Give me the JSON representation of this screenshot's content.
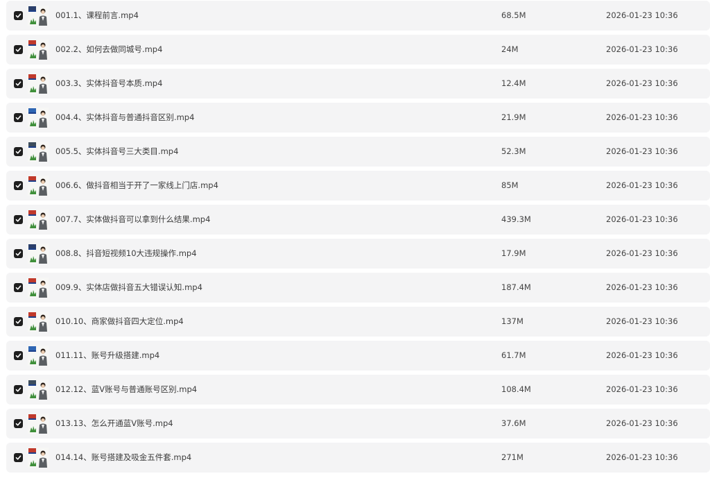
{
  "colors": {
    "row_background": "#f4f4f5",
    "checkbox": "#1f1f1f",
    "text": "#3c3c3c"
  },
  "files": [
    {
      "name": "001.1、课程前言.mp4",
      "size": "68.5M",
      "modified": "2026-01-23 10:36",
      "checked": true,
      "thumb_icon": "video-thumbnail"
    },
    {
      "name": "002.2、如何去做同城号.mp4",
      "size": "24M",
      "modified": "2026-01-23 10:36",
      "checked": true,
      "thumb_icon": "video-thumbnail"
    },
    {
      "name": "003.3、实体抖音号本质.mp4",
      "size": "12.4M",
      "modified": "2026-01-23 10:36",
      "checked": true,
      "thumb_icon": "video-thumbnail"
    },
    {
      "name": "004.4、实体抖音与普通抖音区别.mp4",
      "size": "21.9M",
      "modified": "2026-01-23 10:36",
      "checked": true,
      "thumb_icon": "video-thumbnail"
    },
    {
      "name": "005.5、实体抖音号三大类目.mp4",
      "size": "52.3M",
      "modified": "2026-01-23 10:36",
      "checked": true,
      "thumb_icon": "video-thumbnail"
    },
    {
      "name": "006.6、做抖音相当于开了一家线上门店.mp4",
      "size": "85M",
      "modified": "2026-01-23 10:36",
      "checked": true,
      "thumb_icon": "video-thumbnail"
    },
    {
      "name": "007.7、实体做抖音可以拿到什么结果.mp4",
      "size": "439.3M",
      "modified": "2026-01-23 10:36",
      "checked": true,
      "thumb_icon": "video-thumbnail"
    },
    {
      "name": "008.8、抖音短视频10大违规操作.mp4",
      "size": "17.9M",
      "modified": "2026-01-23 10:36",
      "checked": true,
      "thumb_icon": "video-thumbnail"
    },
    {
      "name": "009.9、实体店做抖音五大错误认知.mp4",
      "size": "187.4M",
      "modified": "2026-01-23 10:36",
      "checked": true,
      "thumb_icon": "video-thumbnail"
    },
    {
      "name": "010.10、商家做抖音四大定位.mp4",
      "size": "137M",
      "modified": "2026-01-23 10:36",
      "checked": true,
      "thumb_icon": "video-thumbnail"
    },
    {
      "name": "011.11、账号升级搭建.mp4",
      "size": "61.7M",
      "modified": "2026-01-23 10:36",
      "checked": true,
      "thumb_icon": "video-thumbnail"
    },
    {
      "name": "012.12、蓝V账号与普通账号区别.mp4",
      "size": "108.4M",
      "modified": "2026-01-23 10:36",
      "checked": true,
      "thumb_icon": "video-thumbnail"
    },
    {
      "name": "013.13、怎么开通蓝V账号.mp4",
      "size": "37.6M",
      "modified": "2026-01-23 10:36",
      "checked": true,
      "thumb_icon": "video-thumbnail"
    },
    {
      "name": "014.14、账号搭建及吸金五件套.mp4",
      "size": "271M",
      "modified": "2026-01-23 10:36",
      "checked": true,
      "thumb_icon": "video-thumbnail"
    }
  ]
}
